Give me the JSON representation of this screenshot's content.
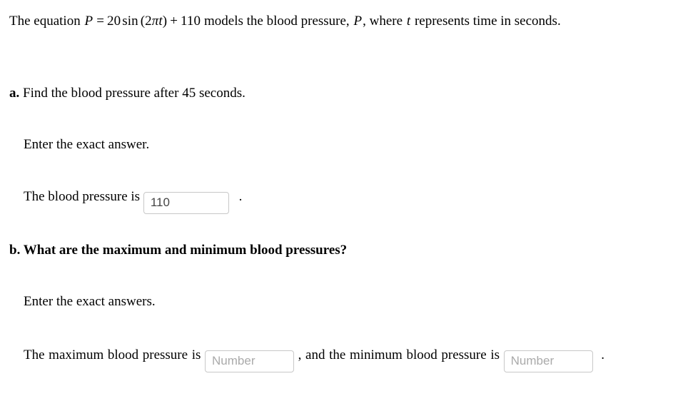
{
  "document": {
    "intro": {
      "text_before_equation": "The equation",
      "equation": {
        "lhs": "P",
        "equals": "=",
        "coefficient": "20",
        "function": "sin",
        "open_paren": "(",
        "argument_coefficient": "2",
        "argument_pi": "π",
        "argument_variable": "t",
        "close_paren": ")",
        "plus": "+",
        "constant": "110",
        "plain": "P = 20 sin (2πt) + 110"
      },
      "text_after_equation_1": "models the blood pressure,",
      "variable_p": "P",
      "comma_1": ",",
      "text_after_equation_2": "where",
      "variable_t": "t",
      "text_after_equation_3": "represents time in seconds."
    },
    "parts": [
      {
        "marker": "a.",
        "question": "Find the blood pressure after 45 seconds.",
        "bold_question": false,
        "instruction": "Enter the exact answer.",
        "answer_prefix": "The blood pressure is",
        "answer_suffix": ".",
        "fields": [
          {
            "name": "blood-pressure-answer",
            "value": "110",
            "placeholder": "Number"
          }
        ]
      },
      {
        "marker": "b.",
        "question": "What are the maximum and minimum blood pressures?",
        "bold_question": true,
        "instruction": "Enter the exact answers.",
        "answer_prefix": "The maximum blood pressure is",
        "answer_middle": ", and the minimum blood pressure is",
        "answer_suffix": ".",
        "fields": [
          {
            "name": "maximum-blood-pressure-answer",
            "value": "",
            "placeholder": "Number"
          },
          {
            "name": "minimum-blood-pressure-answer",
            "value": "",
            "placeholder": "Number"
          }
        ]
      }
    ],
    "colors": {
      "background": "#ffffff",
      "text": "#000000",
      "input_border": "#c8c8c8",
      "input_value_text": "#444444",
      "input_placeholder_text": "#aaaaaa"
    }
  }
}
